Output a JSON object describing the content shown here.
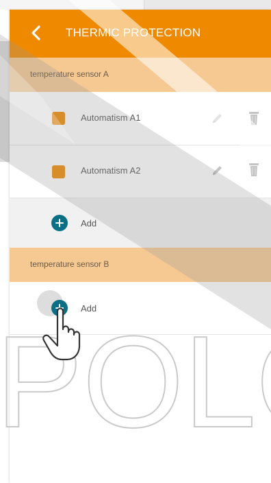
{
  "header": {
    "title": "THERMIC PROTECTION",
    "back_icon": "chevron-left-icon"
  },
  "sections": [
    {
      "title": "temperature sensor A",
      "automatisms": [
        {
          "label": "Automatism A1"
        },
        {
          "label": "Automatism A2"
        }
      ],
      "add_label": "Add"
    },
    {
      "title": "temperature sensor B",
      "automatisms": [],
      "add_label": "Add"
    }
  ],
  "watermark": {
    "text": "POLO"
  },
  "colors": {
    "accent": "#ef8a00",
    "section_bg": "#f6c992",
    "add_button": "#0b6f86",
    "icon_gray": "#c4c4c4"
  }
}
